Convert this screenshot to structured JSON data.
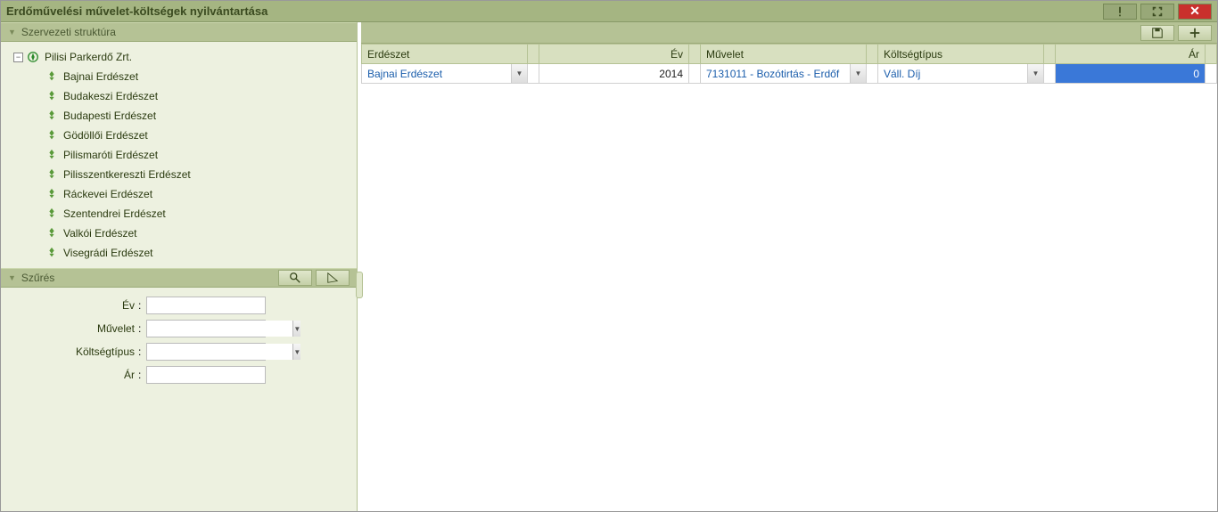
{
  "title": "Erdőművelési művelet-költségek nyilvántartása",
  "sidebar": {
    "struct_header": "Szervezeti struktúra",
    "root": "Pilisi Parkerdő Zrt.",
    "children": [
      "Bajnai Erdészet",
      "Budakeszi Erdészet",
      "Budapesti Erdészet",
      "Gödöllői Erdészet",
      "Pilismaróti Erdészet",
      "Pilisszentkereszti Erdészet",
      "Ráckevei Erdészet",
      "Szentendrei Erdészet",
      "Valkói Erdészet",
      "Visegrádi Erdészet"
    ],
    "filter_header": "Szűrés",
    "filters": {
      "ev_label": "Év",
      "muvelet_label": "Művelet",
      "koltseg_label": "Költségtípus",
      "ar_label": "Ár"
    }
  },
  "grid": {
    "cols": {
      "erdeszet": "Erdészet",
      "ev": "Év",
      "muvelet": "Művelet",
      "koltseg": "Költségtípus",
      "ar": "Ár"
    },
    "row": {
      "erdeszet": "Bajnai Erdészet",
      "ev": "2014",
      "muvelet": "7131011 - Bozótirtás - Erdőf",
      "koltseg": "Váll. Díj",
      "ar": "0"
    }
  }
}
